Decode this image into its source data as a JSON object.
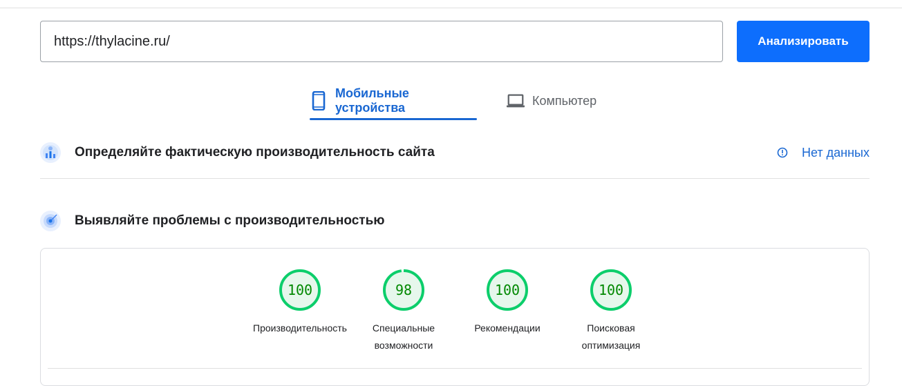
{
  "search": {
    "url_value": "https://thylacine.ru/",
    "analyze_label": "Анализировать"
  },
  "tabs": [
    {
      "label": "Мобильные устройства",
      "icon": "smartphone-icon",
      "active": true
    },
    {
      "label": "Компьютер",
      "icon": "laptop-icon",
      "active": false
    }
  ],
  "crux_section": {
    "title": "Определяйте фактическую производительность сайта",
    "status_label": "Нет данных",
    "status_icon": "info-icon"
  },
  "lab_section": {
    "title": "Выявляйте проблемы с производительностью"
  },
  "scores": [
    {
      "value": "100",
      "fraction": 1.0,
      "label_line1": "Производительность",
      "label_line2": ""
    },
    {
      "value": "98",
      "fraction": 0.98,
      "label_line1": "Специальные",
      "label_line2": "возможности"
    },
    {
      "value": "100",
      "fraction": 1.0,
      "label_line1": "Рекомендации",
      "label_line2": ""
    },
    {
      "value": "100",
      "fraction": 1.0,
      "label_line1": "Поисковая",
      "label_line2": "оптимизация"
    }
  ],
  "colors": {
    "accent": "#1967d2",
    "button": "#0d6efd",
    "score_good": "#0cce6b",
    "score_good_text": "#008800",
    "score_good_fill": "#e6f7ec"
  }
}
